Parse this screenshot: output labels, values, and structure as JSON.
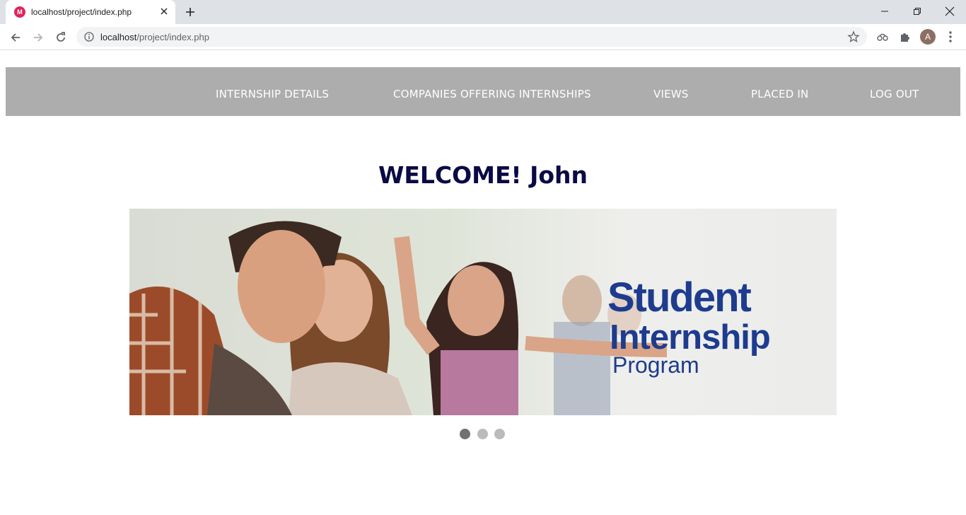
{
  "browser": {
    "tab_title": "localhost/project/index.php",
    "url_host": "localhost",
    "url_path": "/project/index.php",
    "avatar_letter": "A",
    "favicon_letter": "M"
  },
  "nav": {
    "items": [
      {
        "label": "INTERNSHIP DETAILS"
      },
      {
        "label": "COMPANIES OFFERING INTERNSHIPS"
      },
      {
        "label": "VIEWS"
      },
      {
        "label": "PLACED IN"
      },
      {
        "label": "LOG OUT"
      }
    ],
    "background": "#adadad"
  },
  "welcome_text": "WELCOME! John",
  "slideshow": {
    "slide_text": [
      "Student",
      "Internship",
      "Program"
    ],
    "slide_text_color": "#1d3c8f",
    "slide_count": 3,
    "active_slide": 1
  },
  "colors": {
    "welcome": "#0a0a45",
    "dot_active": "#717171",
    "dot_inactive": "#bbbbbb"
  }
}
